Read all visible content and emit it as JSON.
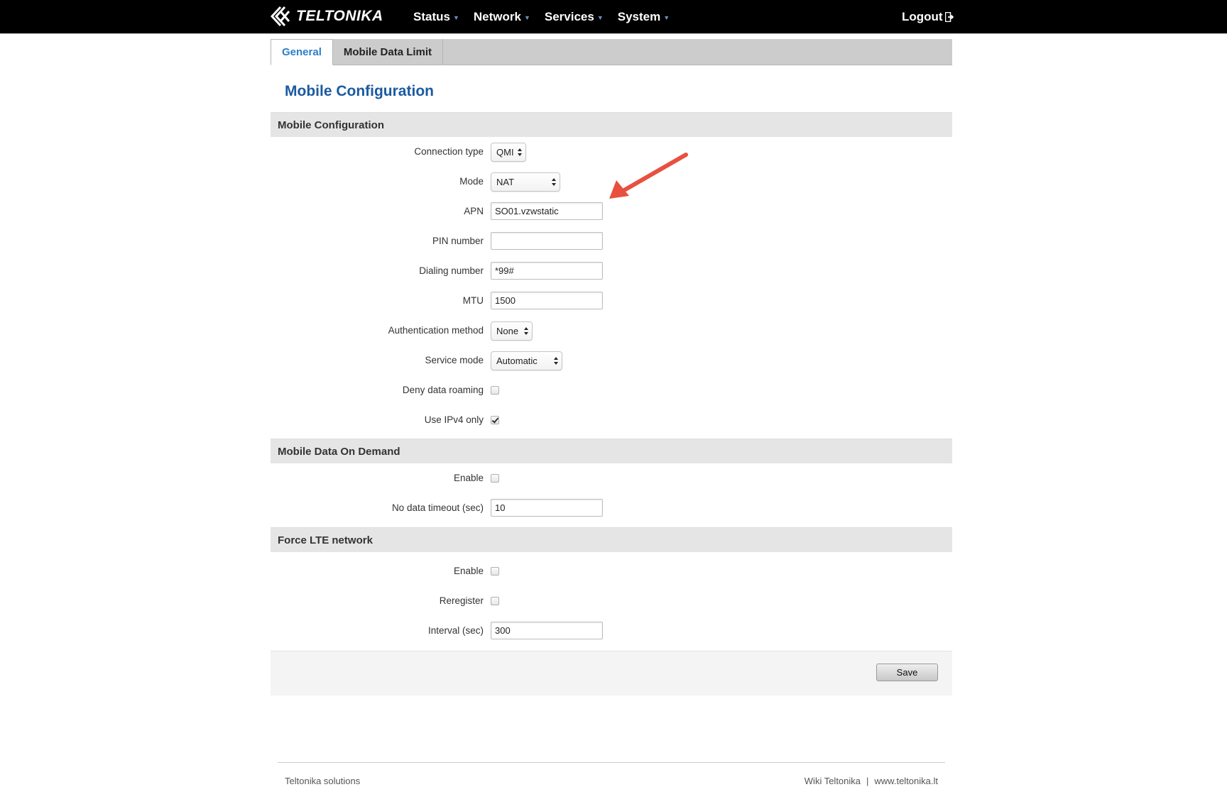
{
  "header": {
    "logo_text": "TELTONIKA",
    "nav": [
      "Status",
      "Network",
      "Services",
      "System"
    ],
    "logout_label": "Logout"
  },
  "tabs": [
    {
      "label": "General",
      "active": true
    },
    {
      "label": "Mobile Data Limit",
      "active": false
    }
  ],
  "page_title": "Mobile Configuration",
  "sections": {
    "mobile_config": {
      "title": "Mobile Configuration",
      "connection_type": {
        "label": "Connection type",
        "value": "QMI"
      },
      "mode": {
        "label": "Mode",
        "value": "NAT"
      },
      "apn": {
        "label": "APN",
        "value": "SO01.vzwstatic"
      },
      "pin": {
        "label": "PIN number",
        "value": ""
      },
      "dialing": {
        "label": "Dialing number",
        "value": "*99#"
      },
      "mtu": {
        "label": "MTU",
        "value": "1500"
      },
      "auth": {
        "label": "Authentication method",
        "value": "None"
      },
      "service_mode": {
        "label": "Service mode",
        "value": "Automatic"
      },
      "deny_roaming": {
        "label": "Deny data roaming",
        "checked": false
      },
      "ipv4_only": {
        "label": "Use IPv4 only",
        "checked": true
      }
    },
    "on_demand": {
      "title": "Mobile Data On Demand",
      "enable": {
        "label": "Enable",
        "checked": false
      },
      "timeout": {
        "label": "No data timeout (sec)",
        "value": "10"
      }
    },
    "force_lte": {
      "title": "Force LTE network",
      "enable": {
        "label": "Enable",
        "checked": false
      },
      "reregister": {
        "label": "Reregister",
        "checked": false
      },
      "interval": {
        "label": "Interval (sec)",
        "value": "300"
      }
    }
  },
  "save_label": "Save",
  "footer": {
    "left": "Teltonika solutions",
    "wiki": "Wiki Teltonika",
    "separator": "|",
    "site": "www.teltonika.lt"
  },
  "colors": {
    "title_blue": "#1b5aa0",
    "tab_active": "#2a7fc9",
    "annotation_arrow": "#e8503f"
  }
}
